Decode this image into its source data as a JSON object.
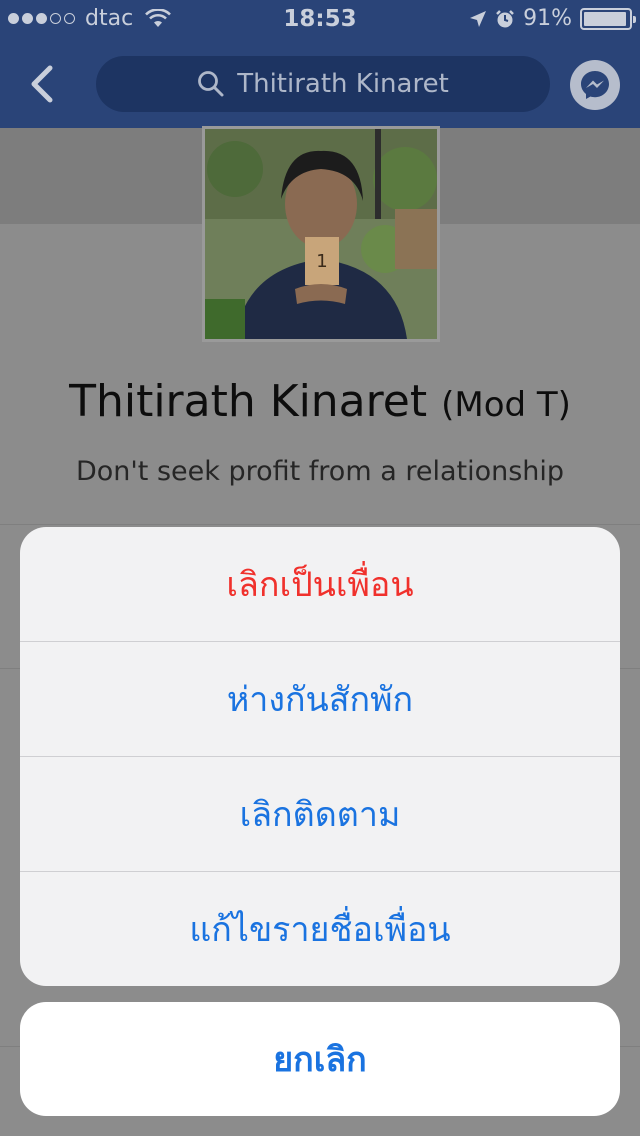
{
  "status_bar": {
    "carrier": "dtac",
    "time": "18:53",
    "battery": "91%",
    "battery_level": 0.91,
    "signal_bars": 3,
    "signal_total": 5
  },
  "nav": {
    "search_text": "Thitirath Kinaret",
    "back_icon": "chevron-left-icon",
    "messenger_icon": "messenger-icon"
  },
  "profile": {
    "name": "Thitirath Kinaret",
    "nickname": "(Mod T)",
    "bio": "Don't seek profit from a relationship",
    "photo_label": "1"
  },
  "action_sheet": {
    "items": [
      {
        "label": "เลิกเป็นเพื่อน",
        "style": "destructive"
      },
      {
        "label": "ห่างกันสักพัก",
        "style": "default"
      },
      {
        "label": "เลิกติดตาม",
        "style": "default"
      },
      {
        "label": "แก้ไขรายชื่อเพื่อน",
        "style": "default"
      }
    ],
    "cancel_label": "ยกเลิก"
  },
  "colors": {
    "accent": "#1a73e0",
    "destructive": "#f0312c",
    "nav_background": "#2a4478"
  }
}
